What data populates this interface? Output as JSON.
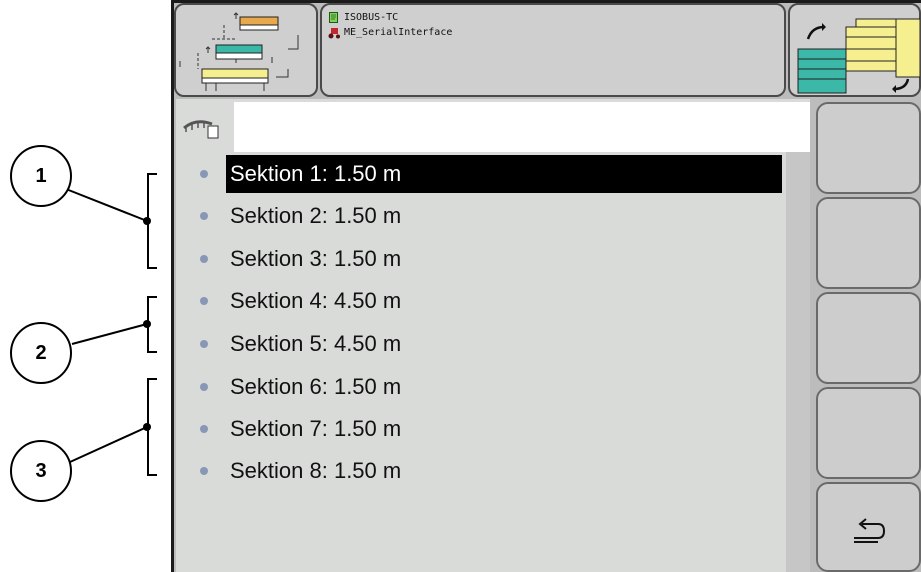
{
  "header": {
    "lines": [
      "ISOBUS-TC",
      "ME_SerialInterface"
    ],
    "icons": [
      "section-config-icon",
      "document-icon",
      "tractor-icon",
      "section-switch-icon"
    ]
  },
  "list": {
    "items": [
      "Sektion 1: 1.50 m",
      "Sektion 2: 1.50 m",
      "Sektion 3: 1.50 m",
      "Sektion 4: 4.50 m",
      "Sektion 5: 4.50 m",
      "Sektion 6: 1.50 m",
      "Sektion 7: 1.50 m",
      "Sektion 8: 1.50 m"
    ],
    "selected_index": 0
  },
  "softkeys": {
    "count": 5,
    "last_icon": "return-arrow-icon"
  },
  "callouts": [
    "1",
    "2",
    "3"
  ],
  "colors": {
    "bullet": "#8897b6",
    "selection": "#000000",
    "section_yellow": "#f5ef90",
    "section_teal": "#3bb8a8",
    "section_orange": "#e8a84c"
  }
}
